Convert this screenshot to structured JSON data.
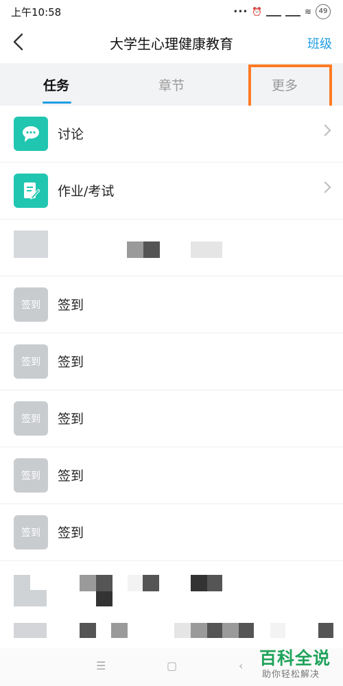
{
  "status": {
    "time": "上午10:58",
    "battery": "49"
  },
  "header": {
    "title": "大学生心理健康教育",
    "right_link": "班级"
  },
  "tabs": [
    {
      "label": "任务",
      "active": true
    },
    {
      "label": "章节",
      "active": false
    },
    {
      "label": "更多",
      "active": false
    }
  ],
  "items": [
    {
      "label": "讨论",
      "icon": "discussion-bubble-icon"
    },
    {
      "label": "作业/考试",
      "icon": "homework-edit-icon"
    }
  ],
  "signins": [
    {
      "label": "签到",
      "icon_text": "签到"
    },
    {
      "label": "签到",
      "icon_text": "签到"
    },
    {
      "label": "签到",
      "icon_text": "签到"
    },
    {
      "label": "签到",
      "icon_text": "签到"
    },
    {
      "label": "签到",
      "icon_text": "签到"
    }
  ],
  "watermark": {
    "title": "百科全说",
    "subtitle": "助你轻松解决"
  },
  "colors": {
    "accent": "#1f9de4",
    "teal_icon": "#20c6b0",
    "highlight": "#ff7b24",
    "watermark": "#1fa35b"
  }
}
